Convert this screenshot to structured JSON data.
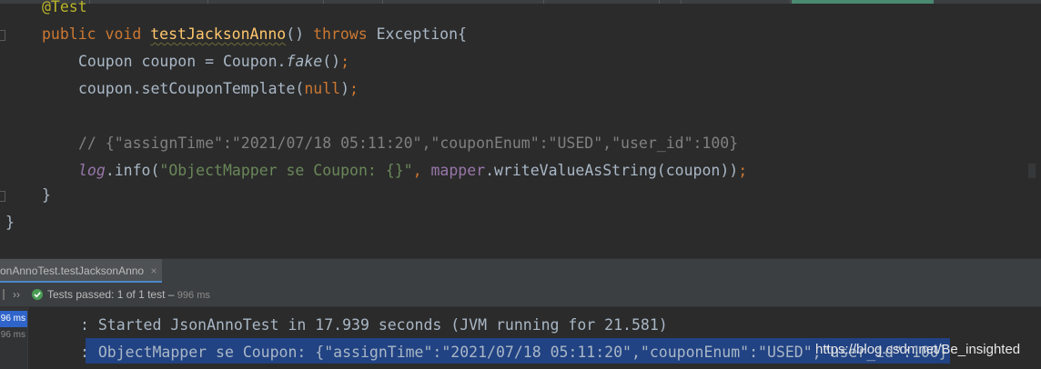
{
  "editor": {
    "lines": {
      "annotation": "@Test",
      "l1_public": "public",
      "l1_void": "void",
      "l1_name": "testJacksonAnno",
      "l1_parens": "()",
      "l1_throws": "throws",
      "l1_rest": "Exception{",
      "l2_a": "Coupon coupon = Coupon.",
      "l2_fake": "fake",
      "l2_b": "()",
      "l2_semi": ";",
      "l3_a": "coupon.setCouponTemplate(",
      "l3_null": "null",
      "l3_b": ")",
      "l3_semi": ";",
      "l5_comment": "// {\"assignTime\":\"2021/07/18 05:11:20\",\"couponEnum\":\"USED\",\"user_id\":100}",
      "l6_log": "log",
      "l6_a": ".info(",
      "l6_str": "\"ObjectMapper se Coupon: {}\"",
      "l6_comma": ", ",
      "l6_mapper": "mapper",
      "l6_b": ".writeValueAsString(coupon))",
      "l6_semi": ";",
      "l7_brace": "}",
      "l8_brace": "}"
    }
  },
  "run_panel": {
    "tab_label": "onAnnoTest.testJacksonAnno",
    "tab_close": "×",
    "toolbar": {
      "expand": "›› ",
      "status_prefix": "Tests passed: ",
      "status_count": "1",
      "status_suffix": " of 1 test – ",
      "status_time": "996 ms"
    },
    "tree": {
      "item1_time": "96 ms",
      "item2_time": "96 ms"
    },
    "console": {
      "line1": ": Started JsonAnnoTest in 17.939 seconds (JVM running for 21.581)",
      "line2_colon": ": ",
      "line2": "ObjectMapper se Coupon: {\"assignTime\":\"2021/07/18 05:11:20\",\"couponEnum\":\"USED\",\"user_id\":100}",
      "watermark": "https://blog.csdn.net/Be_insighted"
    }
  },
  "colors": {
    "keyword": "#cc7832",
    "function": "#ffc66d",
    "string": "#6a8759",
    "comment": "#808080",
    "member": "#9876aa",
    "annotation": "#bbb529",
    "success": "#499c54",
    "selection": "#214283"
  }
}
